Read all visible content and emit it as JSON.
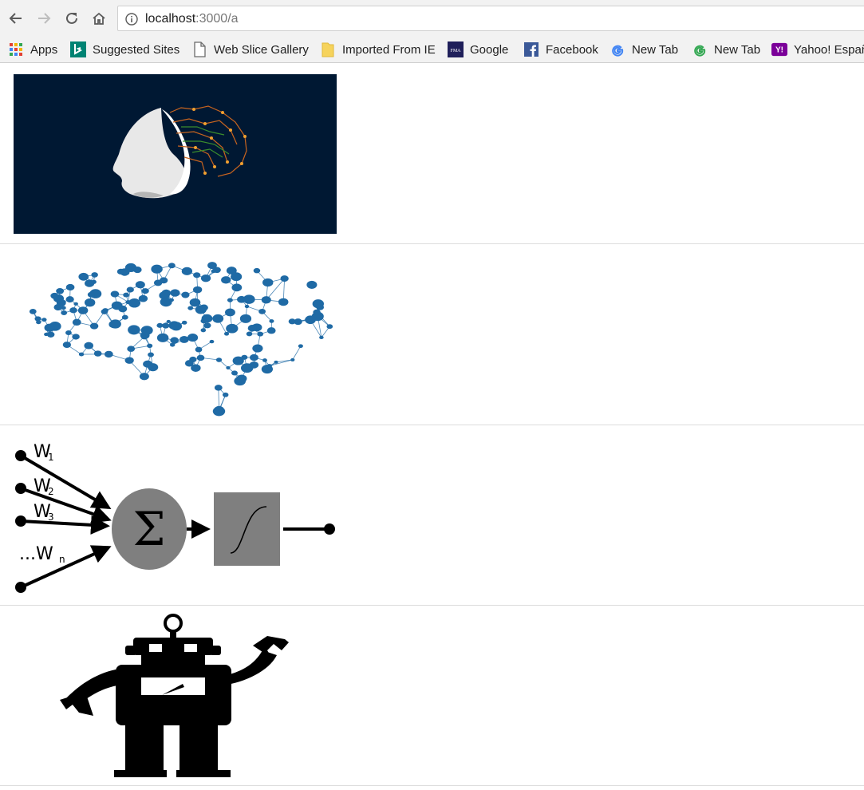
{
  "browser": {
    "url_host": "localhost",
    "url_path": ":3000/a"
  },
  "bookmarks": [
    {
      "label": "Apps",
      "icon": "apps-grid-icon"
    },
    {
      "label": "Suggested Sites",
      "icon": "bing-icon"
    },
    {
      "label": "Web Slice Gallery",
      "icon": "page-icon"
    },
    {
      "label": "Imported From IE",
      "icon": "folder-icon"
    },
    {
      "label": "Google",
      "icon": "fma-icon"
    },
    {
      "label": "Facebook",
      "icon": "facebook-icon"
    },
    {
      "label": "New Tab",
      "icon": "google-g-icon"
    },
    {
      "label": "New Tab",
      "icon": "google-g-icon"
    },
    {
      "label": "Yahoo! Español",
      "icon": "yahoo-icon"
    }
  ],
  "images": [
    {
      "name": "ai-face-circuit-image",
      "bg": "#001833"
    },
    {
      "name": "brain-network-image",
      "node_color": "#1f6aa5"
    },
    {
      "name": "perceptron-diagram-image",
      "labels": [
        "W",
        "1",
        "W",
        "2",
        "W",
        "3",
        "...W",
        "n",
        "Σ"
      ]
    },
    {
      "name": "robot-silhouette-image"
    }
  ]
}
